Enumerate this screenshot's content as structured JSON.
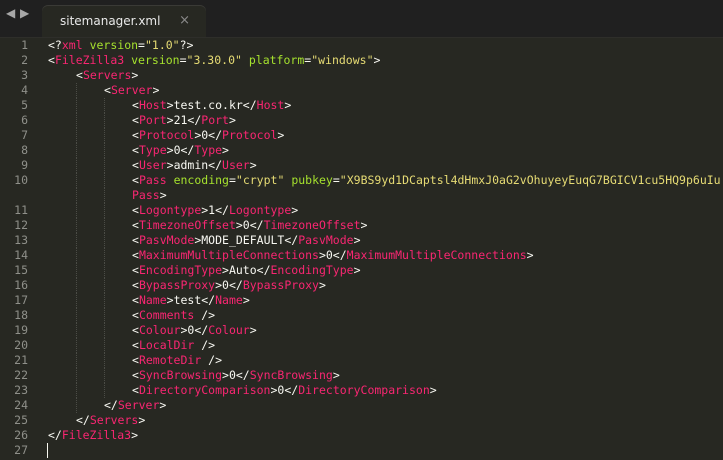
{
  "tab": {
    "nav_left_icon": "chevron-left-icon",
    "nav_right_icon": "chevron-right-icon",
    "filename": "sitemanager.xml",
    "close_glyph": "×"
  },
  "colors": {
    "background": "#272822",
    "tag": "#f92672",
    "attribute": "#a6e22e",
    "string": "#e6db74",
    "text": "#f8f8f2",
    "line_number": "#8f908a"
  },
  "cursor_line": 27,
  "lines": [
    {
      "n": "1",
      "indent": 0,
      "tokens": [
        [
          "p",
          "<?"
        ],
        [
          "t",
          "xml"
        ],
        [
          "p",
          " "
        ],
        [
          "a",
          "version"
        ],
        [
          "p",
          "="
        ],
        [
          "s",
          "\"1.0\""
        ],
        [
          "p",
          "?>"
        ]
      ]
    },
    {
      "n": "2",
      "indent": 0,
      "tokens": [
        [
          "p",
          "<"
        ],
        [
          "t",
          "FileZilla3"
        ],
        [
          "p",
          " "
        ],
        [
          "a",
          "version"
        ],
        [
          "p",
          "="
        ],
        [
          "s",
          "\"3.30.0\""
        ],
        [
          "p",
          " "
        ],
        [
          "a",
          "platform"
        ],
        [
          "p",
          "="
        ],
        [
          "s",
          "\"windows\""
        ],
        [
          "p",
          ">"
        ]
      ]
    },
    {
      "n": "3",
      "indent": 1,
      "tokens": [
        [
          "p",
          "<"
        ],
        [
          "t",
          "Servers"
        ],
        [
          "p",
          ">"
        ]
      ]
    },
    {
      "n": "4",
      "indent": 2,
      "tokens": [
        [
          "p",
          "<"
        ],
        [
          "t",
          "Server"
        ],
        [
          "p",
          ">"
        ]
      ]
    },
    {
      "n": "5",
      "indent": 3,
      "tokens": [
        [
          "p",
          "<"
        ],
        [
          "t",
          "Host"
        ],
        [
          "p",
          ">test.co.kr</"
        ],
        [
          "t",
          "Host"
        ],
        [
          "p",
          ">"
        ]
      ]
    },
    {
      "n": "6",
      "indent": 3,
      "tokens": [
        [
          "p",
          "<"
        ],
        [
          "t",
          "Port"
        ],
        [
          "p",
          ">21</"
        ],
        [
          "t",
          "Port"
        ],
        [
          "p",
          ">"
        ]
      ]
    },
    {
      "n": "7",
      "indent": 3,
      "tokens": [
        [
          "p",
          "<"
        ],
        [
          "t",
          "Protocol"
        ],
        [
          "p",
          ">0</"
        ],
        [
          "t",
          "Protocol"
        ],
        [
          "p",
          ">"
        ]
      ]
    },
    {
      "n": "8",
      "indent": 3,
      "tokens": [
        [
          "p",
          "<"
        ],
        [
          "t",
          "Type"
        ],
        [
          "p",
          ">0</"
        ],
        [
          "t",
          "Type"
        ],
        [
          "p",
          ">"
        ]
      ]
    },
    {
      "n": "9",
      "indent": 3,
      "tokens": [
        [
          "p",
          "<"
        ],
        [
          "t",
          "User"
        ],
        [
          "p",
          ">admin</"
        ],
        [
          "t",
          "User"
        ],
        [
          "p",
          ">"
        ]
      ]
    },
    {
      "n": "10",
      "indent": 3,
      "tokens": [
        [
          "p",
          "<"
        ],
        [
          "t",
          "Pass"
        ],
        [
          "p",
          " "
        ],
        [
          "a",
          "encoding"
        ],
        [
          "p",
          "="
        ],
        [
          "s",
          "\"crypt\""
        ],
        [
          "p",
          " "
        ],
        [
          "a",
          "pubkey"
        ],
        [
          "p",
          "="
        ],
        [
          "s",
          "\"X9BS9yd1DCaptsl4dHmxJ0aG2vOhuyeyEuqG7BGICV1cu5HQ9p6uIu"
        ]
      ]
    },
    {
      "n": "",
      "indent": 3,
      "tokens": [
        [
          "t",
          "Pass"
        ],
        [
          "p",
          ">"
        ]
      ]
    },
    {
      "n": "11",
      "indent": 3,
      "tokens": [
        [
          "p",
          "<"
        ],
        [
          "t",
          "Logontype"
        ],
        [
          "p",
          ">1</"
        ],
        [
          "t",
          "Logontype"
        ],
        [
          "p",
          ">"
        ]
      ]
    },
    {
      "n": "12",
      "indent": 3,
      "tokens": [
        [
          "p",
          "<"
        ],
        [
          "t",
          "TimezoneOffset"
        ],
        [
          "p",
          ">0</"
        ],
        [
          "t",
          "TimezoneOffset"
        ],
        [
          "p",
          ">"
        ]
      ]
    },
    {
      "n": "13",
      "indent": 3,
      "tokens": [
        [
          "p",
          "<"
        ],
        [
          "t",
          "PasvMode"
        ],
        [
          "p",
          ">MODE_DEFAULT</"
        ],
        [
          "t",
          "PasvMode"
        ],
        [
          "p",
          ">"
        ]
      ]
    },
    {
      "n": "14",
      "indent": 3,
      "tokens": [
        [
          "p",
          "<"
        ],
        [
          "t",
          "MaximumMultipleConnections"
        ],
        [
          "p",
          ">0</"
        ],
        [
          "t",
          "MaximumMultipleConnections"
        ],
        [
          "p",
          ">"
        ]
      ]
    },
    {
      "n": "15",
      "indent": 3,
      "tokens": [
        [
          "p",
          "<"
        ],
        [
          "t",
          "EncodingType"
        ],
        [
          "p",
          ">Auto</"
        ],
        [
          "t",
          "EncodingType"
        ],
        [
          "p",
          ">"
        ]
      ]
    },
    {
      "n": "16",
      "indent": 3,
      "tokens": [
        [
          "p",
          "<"
        ],
        [
          "t",
          "BypassProxy"
        ],
        [
          "p",
          ">0</"
        ],
        [
          "t",
          "BypassProxy"
        ],
        [
          "p",
          ">"
        ]
      ]
    },
    {
      "n": "17",
      "indent": 3,
      "tokens": [
        [
          "p",
          "<"
        ],
        [
          "t",
          "Name"
        ],
        [
          "p",
          ">test</"
        ],
        [
          "t",
          "Name"
        ],
        [
          "p",
          ">"
        ]
      ]
    },
    {
      "n": "18",
      "indent": 3,
      "tokens": [
        [
          "p",
          "<"
        ],
        [
          "t",
          "Comments"
        ],
        [
          "p",
          " />"
        ]
      ]
    },
    {
      "n": "19",
      "indent": 3,
      "tokens": [
        [
          "p",
          "<"
        ],
        [
          "t",
          "Colour"
        ],
        [
          "p",
          ">0</"
        ],
        [
          "t",
          "Colour"
        ],
        [
          "p",
          ">"
        ]
      ]
    },
    {
      "n": "20",
      "indent": 3,
      "tokens": [
        [
          "p",
          "<"
        ],
        [
          "t",
          "LocalDir"
        ],
        [
          "p",
          " />"
        ]
      ]
    },
    {
      "n": "21",
      "indent": 3,
      "tokens": [
        [
          "p",
          "<"
        ],
        [
          "t",
          "RemoteDir"
        ],
        [
          "p",
          " />"
        ]
      ]
    },
    {
      "n": "22",
      "indent": 3,
      "tokens": [
        [
          "p",
          "<"
        ],
        [
          "t",
          "SyncBrowsing"
        ],
        [
          "p",
          ">0</"
        ],
        [
          "t",
          "SyncBrowsing"
        ],
        [
          "p",
          ">"
        ]
      ]
    },
    {
      "n": "23",
      "indent": 3,
      "tokens": [
        [
          "p",
          "<"
        ],
        [
          "t",
          "DirectoryComparison"
        ],
        [
          "p",
          ">0</"
        ],
        [
          "t",
          "DirectoryComparison"
        ],
        [
          "p",
          ">"
        ]
      ]
    },
    {
      "n": "24",
      "indent": 2,
      "tokens": [
        [
          "p",
          "</"
        ],
        [
          "t",
          "Server"
        ],
        [
          "p",
          ">"
        ]
      ]
    },
    {
      "n": "25",
      "indent": 1,
      "tokens": [
        [
          "p",
          "</"
        ],
        [
          "t",
          "Servers"
        ],
        [
          "p",
          ">"
        ]
      ]
    },
    {
      "n": "26",
      "indent": 0,
      "tokens": [
        [
          "p",
          "</"
        ],
        [
          "t",
          "FileZilla3"
        ],
        [
          "p",
          ">"
        ]
      ]
    },
    {
      "n": "27",
      "indent": 0,
      "tokens": []
    }
  ]
}
